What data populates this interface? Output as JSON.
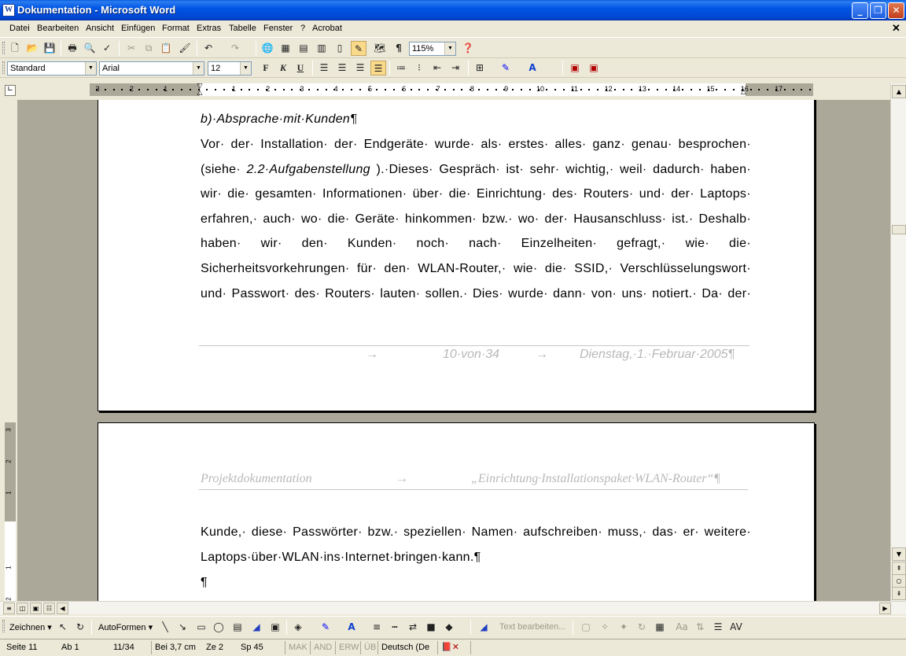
{
  "window": {
    "title": "Dokumentation - Microsoft Word",
    "app_icon": "W",
    "buttons": {
      "minimize": "_",
      "restore": "❐",
      "close": "✕"
    }
  },
  "menu": {
    "items": [
      "Datei",
      "Bearbeiten",
      "Ansicht",
      "Einfügen",
      "Format",
      "Extras",
      "Tabelle",
      "Fenster",
      "?",
      "Acrobat"
    ],
    "close_doc": "✕"
  },
  "toolbar": {
    "zoom": "115%",
    "style": "Standard",
    "font": "Arial",
    "size": "12",
    "bold": "F",
    "italic": "K",
    "underline": "U"
  },
  "ruler": {
    "numbers": [
      "3",
      "2",
      "1",
      "1",
      "2",
      "3",
      "4",
      "5",
      "6",
      "7",
      "8",
      "9",
      "10",
      "11",
      "12",
      "13",
      "14",
      "15",
      "16",
      "17"
    ],
    "vnumbers": [
      "3",
      "2",
      "1",
      "1",
      "2"
    ]
  },
  "page1": {
    "heading": "b)·Absprache·mit·Kunden¶",
    "lines": [
      [
        "Vor·",
        "der·",
        "Installation·",
        "der·",
        "Endgeräte·",
        "wurde·",
        "als·",
        "erstes·",
        "alles·",
        "ganz·",
        "genau·",
        "besprochen·"
      ],
      [
        "(siehe·",
        "2.2·Aufgabenstellung",
        ").·Dieses·",
        "Gespräch·",
        "ist·",
        "sehr·",
        "wichtig,·",
        "weil·",
        "dadurch·",
        "haben·"
      ],
      [
        "wir·",
        "die·",
        "gesamten·",
        "Informationen·",
        "über·",
        "die·",
        "Einrichtung·",
        "des·",
        "Routers·",
        "und·",
        "der·",
        "Laptops·"
      ],
      [
        "erfahren,·",
        "auch·",
        "wo·",
        "die·",
        "Geräte·",
        "hinkommen·",
        "bzw.·",
        "wo·",
        "der·",
        "Hausanschluss·",
        "ist.·",
        "Deshalb·"
      ],
      [
        "haben·",
        "wir·",
        "den·",
        "Kunden·",
        "noch·",
        "nach·",
        "Einzelheiten·",
        "gefragt,·",
        "wie·",
        "die·"
      ],
      [
        "Sicherheitsvorkehrungen·",
        "für·",
        "den·",
        "WLAN-Router,·",
        "wie·",
        "die·",
        "SSID,·",
        "Verschlüsselungswort·"
      ],
      [
        "und·",
        "Passwort·",
        "des·",
        "Routers·",
        "lauten·",
        "sollen.·",
        "Dies·",
        "wurde·",
        "dann·",
        "von·",
        "uns·",
        "notiert.·",
        "Da·",
        "der·"
      ]
    ],
    "footer": {
      "arrow1": "→",
      "pages": "10·von·34",
      "arrow2": "→",
      "date": "Dienstag,·1.·Februar·2005¶"
    }
  },
  "page2": {
    "header": {
      "left": "Projektdokumentation",
      "arrow": "→",
      "right": "„Einrichtung·Installationspaket·WLAN-Router“¶"
    },
    "lines": [
      [
        "Kunde,·",
        "diese·",
        "Passwörter·",
        "bzw.·",
        "speziellen·",
        "Namen·",
        "aufschreiben·",
        "muss,·",
        "das·",
        "er·",
        "weitere·"
      ],
      [
        "Laptops·über·WLAN·ins·Internet·bringen·kann.¶"
      ]
    ],
    "empty_para": "¶"
  },
  "drawbar": {
    "draw": "Zeichnen ▾",
    "autoshapes": "AutoFormen ▾",
    "edit_text": "Text bearbeiten..."
  },
  "status": {
    "page": "Seite 11",
    "section": "Ab 1",
    "pages": "11/34",
    "at": "Bei 3,7 cm",
    "line": "Ze 2",
    "col": "Sp 45",
    "rec": "MAK",
    "trk": "AND",
    "ext": "ERW",
    "ovr": "ÜB",
    "lang": "Deutsch (De"
  }
}
